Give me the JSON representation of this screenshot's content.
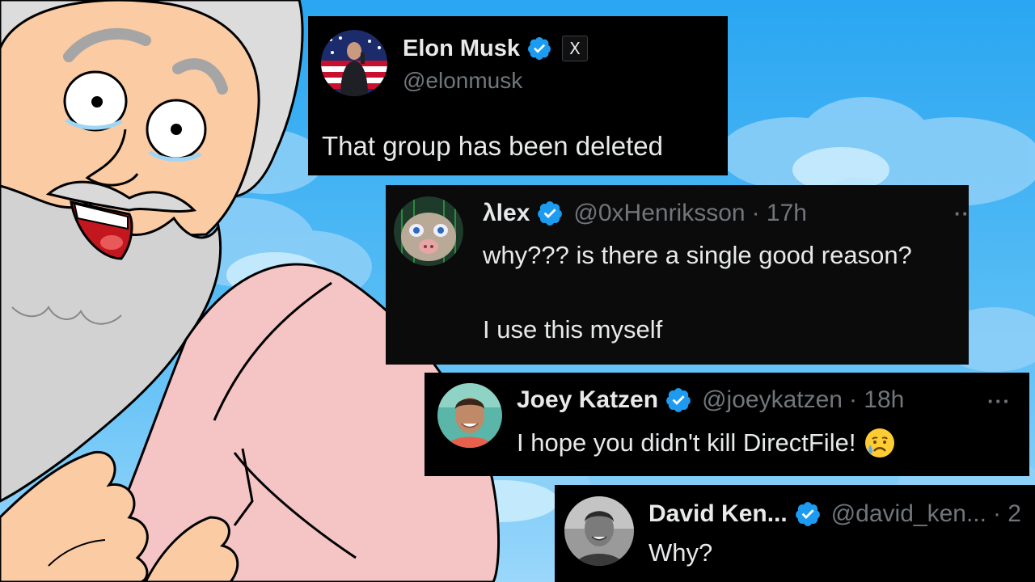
{
  "tweets": [
    {
      "name": "Elon Musk",
      "handle": "@elonmusk",
      "time": "",
      "affiliate_label": "X",
      "body": "That group has been deleted"
    },
    {
      "name": "λlex",
      "handle": "@0xHenriksson",
      "time": "· 17h",
      "body_line1": "why??? is there a single good reason?",
      "body_line2": "I use this myself"
    },
    {
      "name": "Joey Katzen",
      "handle": "@joeykatzen",
      "time": "· 18h",
      "body": "I hope you didn't kill DirectFile!",
      "emoji": "😥"
    },
    {
      "name": "David Ken...",
      "handle": "@david_ken...",
      "time": "· 2",
      "body": "Why?"
    }
  ],
  "colors": {
    "card_bg": "#000000",
    "text": "#e7e9ea",
    "muted": "#71767b",
    "verified": "#1d9bf0",
    "sky": "#3daeef"
  },
  "icons": [
    "verified-badge-icon",
    "x-logo-icon",
    "more-options-icon",
    "sad-tear-emoji"
  ]
}
